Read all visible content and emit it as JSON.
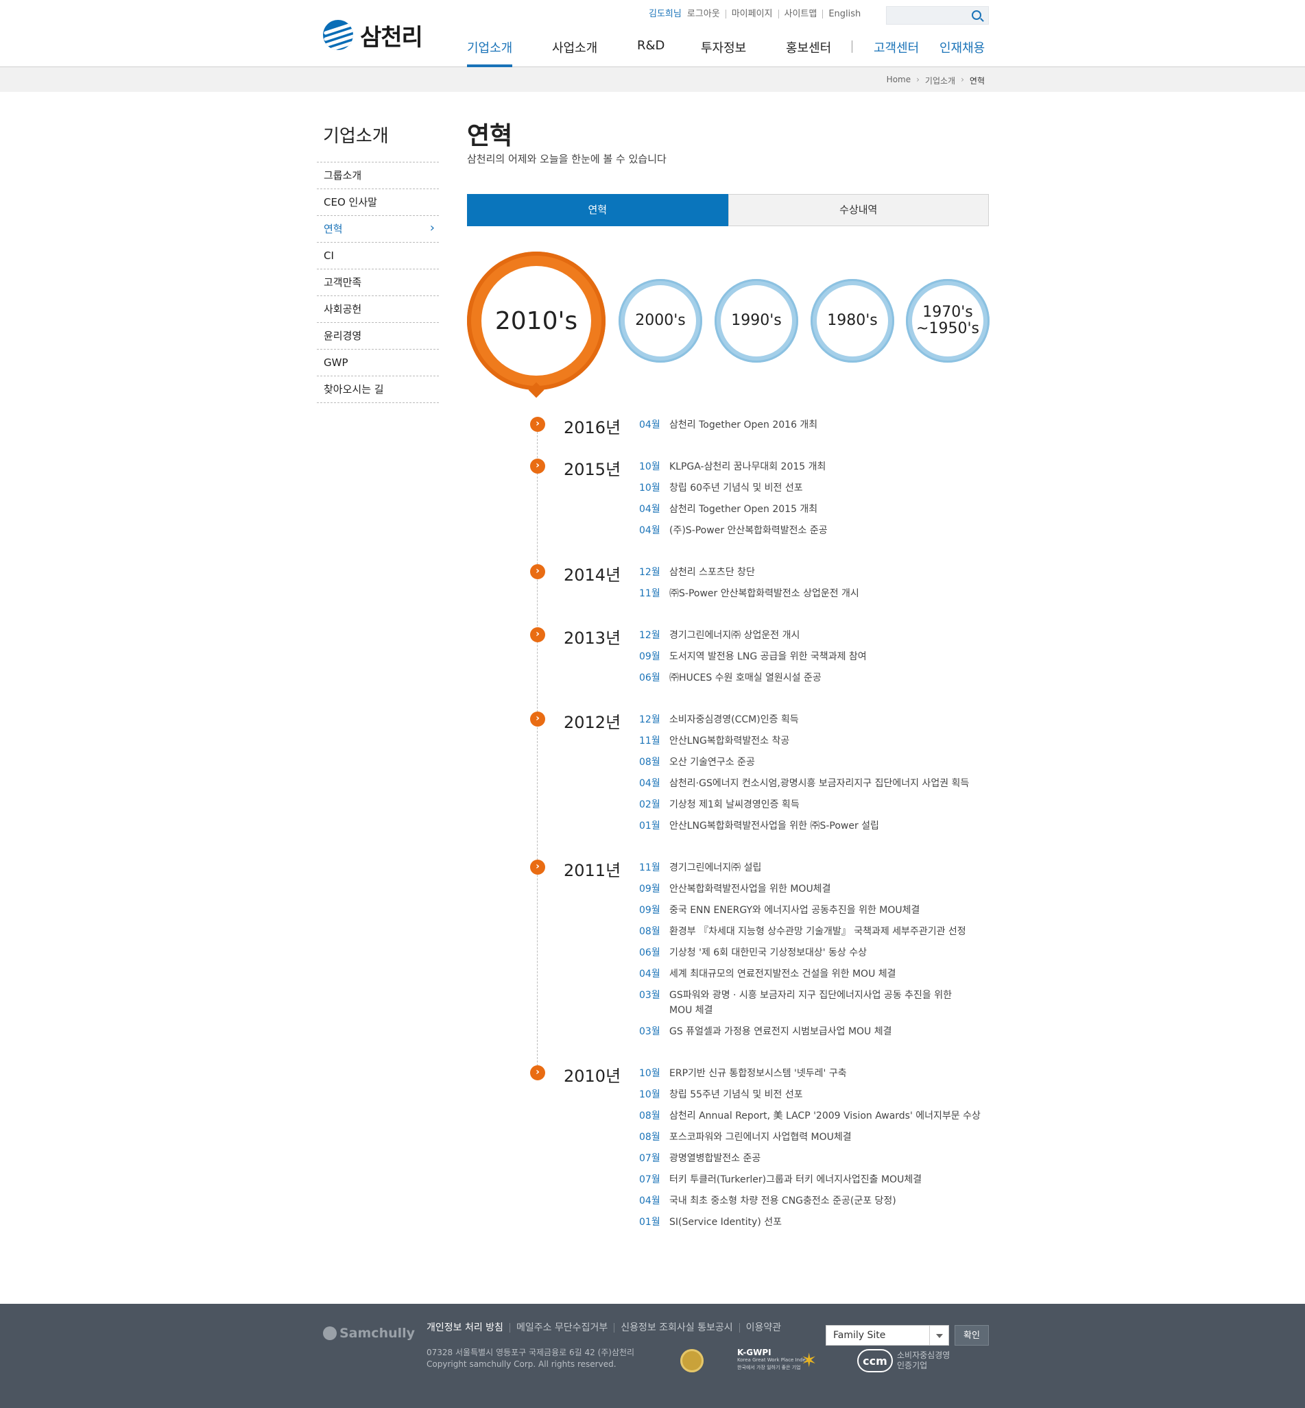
{
  "header": {
    "logo_text": "삼천리",
    "util": {
      "user": "김도희님",
      "logout": "로그아웃",
      "mypage": "마이페이지",
      "sitemap": "사이트맵",
      "english": "English"
    },
    "search_placeholder": "",
    "gnb": [
      "기업소개",
      "사업소개",
      "R&D",
      "투자정보",
      "홍보센터",
      "고객센터",
      "인재채용"
    ]
  },
  "breadcrumb": {
    "home": "Home",
    "section": "기업소개",
    "current": "연혁"
  },
  "lnb": {
    "title": "기업소개",
    "items": [
      "그룹소개",
      "CEO 인사말",
      "연혁",
      "CI",
      "고객만족",
      "사회공헌",
      "윤리경영",
      "GWP",
      "찾아오시는 길"
    ],
    "active_index": 2
  },
  "content": {
    "title": "연혁",
    "subtitle": "삼천리의 어제와 오늘을 한눈에 볼 수 있습니다",
    "tabs": [
      "연혁",
      "수상내역"
    ],
    "decades": [
      "2010's",
      "2000's",
      "1990's",
      "1980's",
      "1970's\n~1950's"
    ]
  },
  "timeline": [
    {
      "year": "2016년",
      "events": [
        {
          "m": "04월",
          "t": "삼천리 Together Open 2016 개최"
        }
      ]
    },
    {
      "year": "2015년",
      "events": [
        {
          "m": "10월",
          "t": "KLPGA-삼천리 꿈나무대회 2015 개최"
        },
        {
          "m": "10월",
          "t": "창립 60주년 기념식 및 비전 선포"
        },
        {
          "m": "04월",
          "t": "삼천리 Together Open 2015 개최"
        },
        {
          "m": "04월",
          "t": "(주)S-Power 안산복합화력발전소 준공"
        }
      ]
    },
    {
      "year": "2014년",
      "events": [
        {
          "m": "12월",
          "t": "삼천리 스포츠단 창단"
        },
        {
          "m": "11월",
          "t": "㈜S-Power 안산복합화력발전소 상업운전 개시"
        }
      ]
    },
    {
      "year": "2013년",
      "events": [
        {
          "m": "12월",
          "t": "경기그린에너지㈜ 상업운전 개시"
        },
        {
          "m": "09월",
          "t": "도서지역 발전용 LNG 공급을 위한 국책과제 참여"
        },
        {
          "m": "06월",
          "t": "㈜HUCES 수원 호매실 열원시설 준공"
        }
      ]
    },
    {
      "year": "2012년",
      "events": [
        {
          "m": "12월",
          "t": "소비자중심경영(CCM)인증 획득"
        },
        {
          "m": "11월",
          "t": "안산LNG복합화력발전소 착공"
        },
        {
          "m": "08월",
          "t": "오산 기술연구소 준공"
        },
        {
          "m": "04월",
          "t": "삼천리·GS에너지 컨소시엄,광명시흥 보금자리지구 집단에너지 사업권 획득"
        },
        {
          "m": "02월",
          "t": "기상청 제1회 날씨경영인증 획득"
        },
        {
          "m": "01월",
          "t": "안산LNG복합화력발전사업을 위한 ㈜S-Power 설립"
        }
      ]
    },
    {
      "year": "2011년",
      "events": [
        {
          "m": "11월",
          "t": "경기그린에너지㈜ 설립"
        },
        {
          "m": "09월",
          "t": "안산복합화력발전사업을 위한 MOU체결"
        },
        {
          "m": "09월",
          "t": "중국 ENN ENERGY와 에너지사업 공동추진을 위한 MOU체결"
        },
        {
          "m": "08월",
          "t": "환경부 『차세대 지능형 상수관망 기술개발』 국책과제 세부주관기관 선정"
        },
        {
          "m": "06월",
          "t": "기상청 '제 6회 대한민국 기상정보대상' 동상 수상"
        },
        {
          "m": "04월",
          "t": "세계 최대규모의 연료전지발전소 건설을 위한 MOU 체결"
        },
        {
          "m": "03월",
          "t": "GS파워와 광명 · 시흥 보금자리 지구 집단에너지사업 공동 추진을 위한\nMOU 체결"
        },
        {
          "m": "03월",
          "t": "GS 퓨얼셀과 가정용 연료전지 시범보급사업 MOU 체결"
        }
      ]
    },
    {
      "year": "2010년",
      "events": [
        {
          "m": "10월",
          "t": "ERP기반 신규 통합정보시스템 '넷두레' 구축"
        },
        {
          "m": "10월",
          "t": "창립 55주년 기념식 및 비전 선포"
        },
        {
          "m": "08월",
          "t": "삼천리 Annual Report, 美 LACP '2009 Vision Awards' 에너지부문 수상"
        },
        {
          "m": "08월",
          "t": "포스코파워와 그린에너지 사업협력 MOU체결"
        },
        {
          "m": "07월",
          "t": "광명열병합발전소 준공"
        },
        {
          "m": "07월",
          "t": "터키 투클러(Turkerler)그룹과 터키 에너지사업진출 MOU체결"
        },
        {
          "m": "04월",
          "t": "국내 최초 중소형 차량 전용 CNG충전소 준공(군포 당정)"
        },
        {
          "m": "01월",
          "t": "SI(Service Identity) 선포"
        }
      ]
    }
  ],
  "footer": {
    "logo": "Samchully",
    "links": [
      "개인정보 처리 방침",
      "메일주소 무단수집거부",
      "신용정보 조회사실 통보공시",
      "이용약관"
    ],
    "address": "07328 서울특별시 영등포구 국제금융로 6길 42 (주)삼천리",
    "copyright": "Copyright samchully Corp. All rights reserved.",
    "kgwpi": "K-GWPI",
    "kgwpi_sub1": "Korea Great Work Place Index",
    "kgwpi_sub2": "한국에서 가장 일하기 좋은 기업",
    "ccm": "ccm",
    "ccm_label": "소비자중심경영\n인증기업",
    "family_site": "Family Site",
    "confirm": "확인"
  }
}
